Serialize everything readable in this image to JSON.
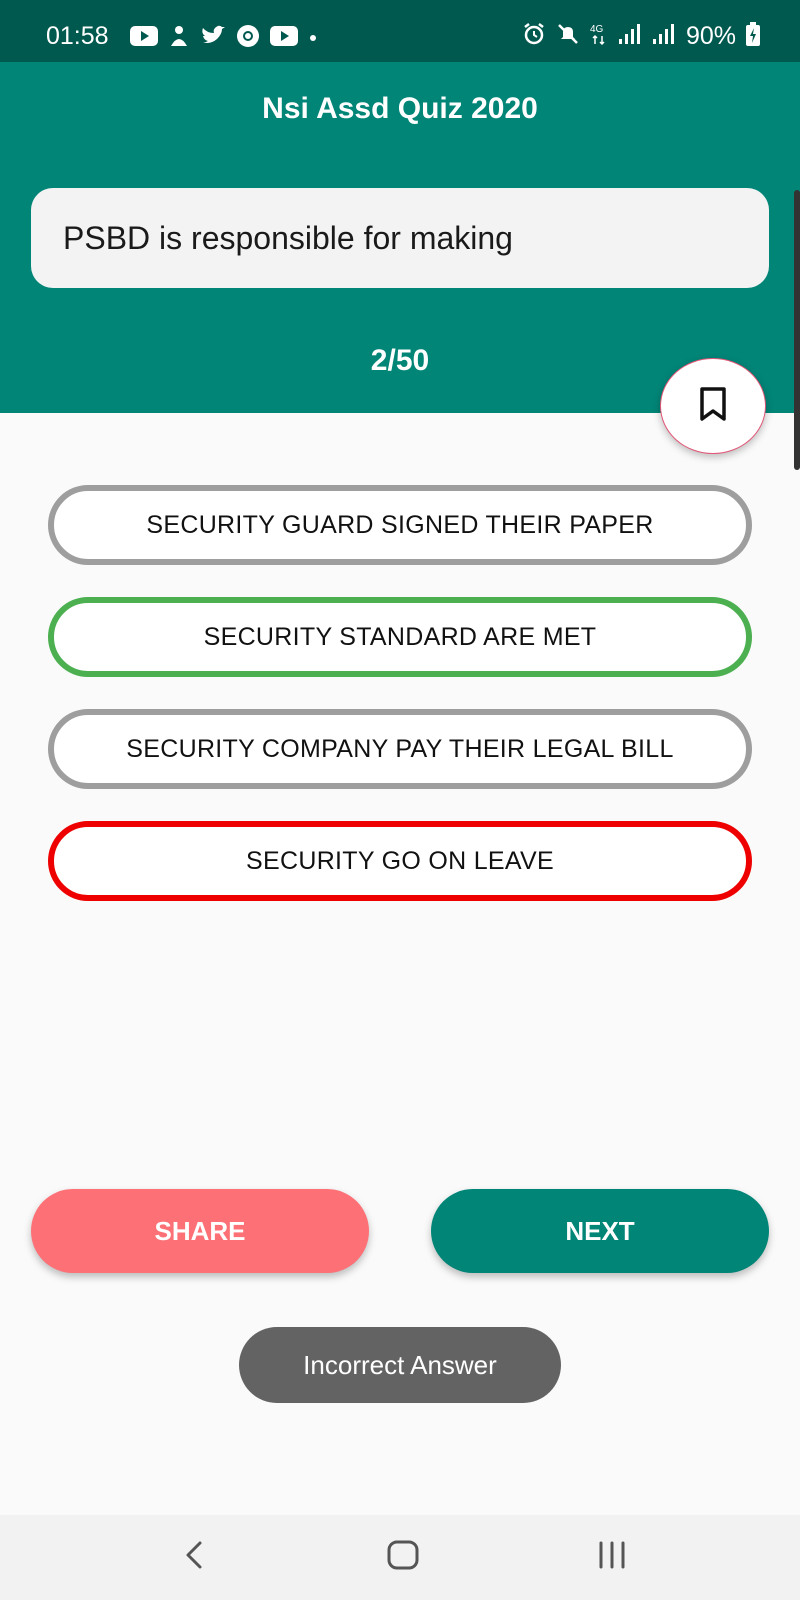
{
  "status_bar": {
    "time": "01:58",
    "left_icons": [
      "youtube-icon",
      "notification-icon",
      "twitter-icon",
      "chrome-icon",
      "youtube-icon",
      "dot-icon"
    ],
    "right_icons": [
      "alarm-icon",
      "mute-icon",
      "4g-icon",
      "signal-icon",
      "signal-icon",
      "battery-icon"
    ],
    "battery": "90%"
  },
  "header": {
    "title": "Nsi Assd Quiz 2020",
    "question": "PSBD is responsible for making",
    "progress": "2/50",
    "bookmark_icon": "bookmark-icon"
  },
  "options": [
    {
      "label": "SECURITY GUARD SIGNED THEIR PAPER",
      "state": "neutral"
    },
    {
      "label": "SECURITY STANDARD ARE MET",
      "state": "correct"
    },
    {
      "label": "SECURITY COMPANY PAY THEIR LEGAL BILL",
      "state": "neutral"
    },
    {
      "label": "SECURITY GO ON LEAVE",
      "state": "wrong"
    }
  ],
  "actions": {
    "share_label": "SHARE",
    "next_label": "NEXT"
  },
  "toast": {
    "message": "Incorrect Answer"
  },
  "nav": {
    "back_icon": "back-icon",
    "home_icon": "home-icon",
    "recents_icon": "recents-icon"
  },
  "colors": {
    "primary": "#008577",
    "status_bar": "#00594f",
    "share": "#fc7076",
    "correct": "#4caf50",
    "wrong": "#ee0000",
    "neutral_border": "#9e9e9e",
    "toast": "#636363"
  }
}
